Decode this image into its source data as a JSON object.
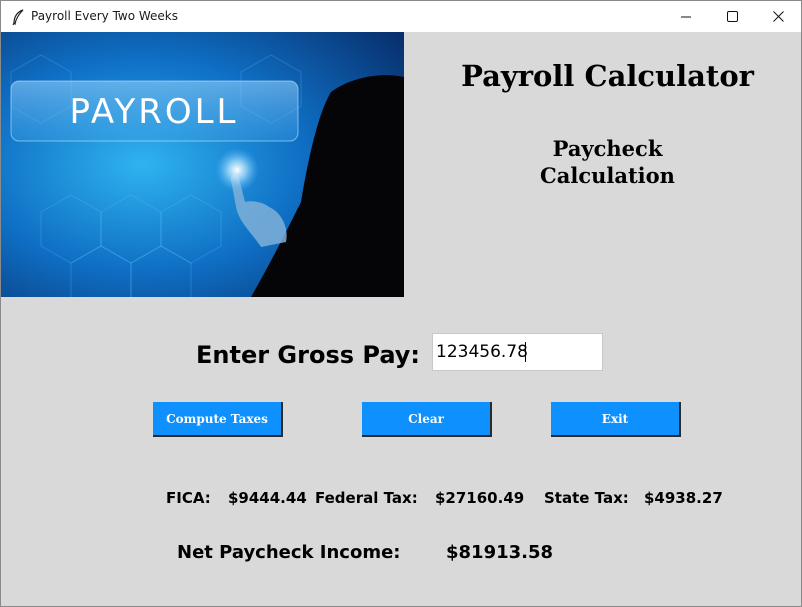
{
  "window": {
    "title": "Payroll Every Two Weeks"
  },
  "hero": {
    "image_text": "PAYROLL"
  },
  "headings": {
    "app_title": "Payroll Calculator",
    "sub_title_line1": "Paycheck",
    "sub_title_line2": "Calculation"
  },
  "form": {
    "gross_label": "Enter Gross Pay:",
    "gross_value": "123456.78"
  },
  "buttons": {
    "compute": "Compute Taxes",
    "clear": "Clear",
    "exit": "Exit"
  },
  "results": {
    "fica_label": "FICA:",
    "fica_value": "$9444.44",
    "federal_label": "Federal Tax:",
    "federal_value": "$27160.49",
    "state_label": "State Tax:",
    "state_value": "$4938.27",
    "net_label": "Net Paycheck Income:",
    "net_value": "$81913.58"
  },
  "colors": {
    "background": "#d9d9d9",
    "button": "#0e90ff",
    "button_text": "#ffffff"
  },
  "icons": [
    "feather-icon",
    "minimize-icon",
    "maximize-icon",
    "close-icon"
  ]
}
